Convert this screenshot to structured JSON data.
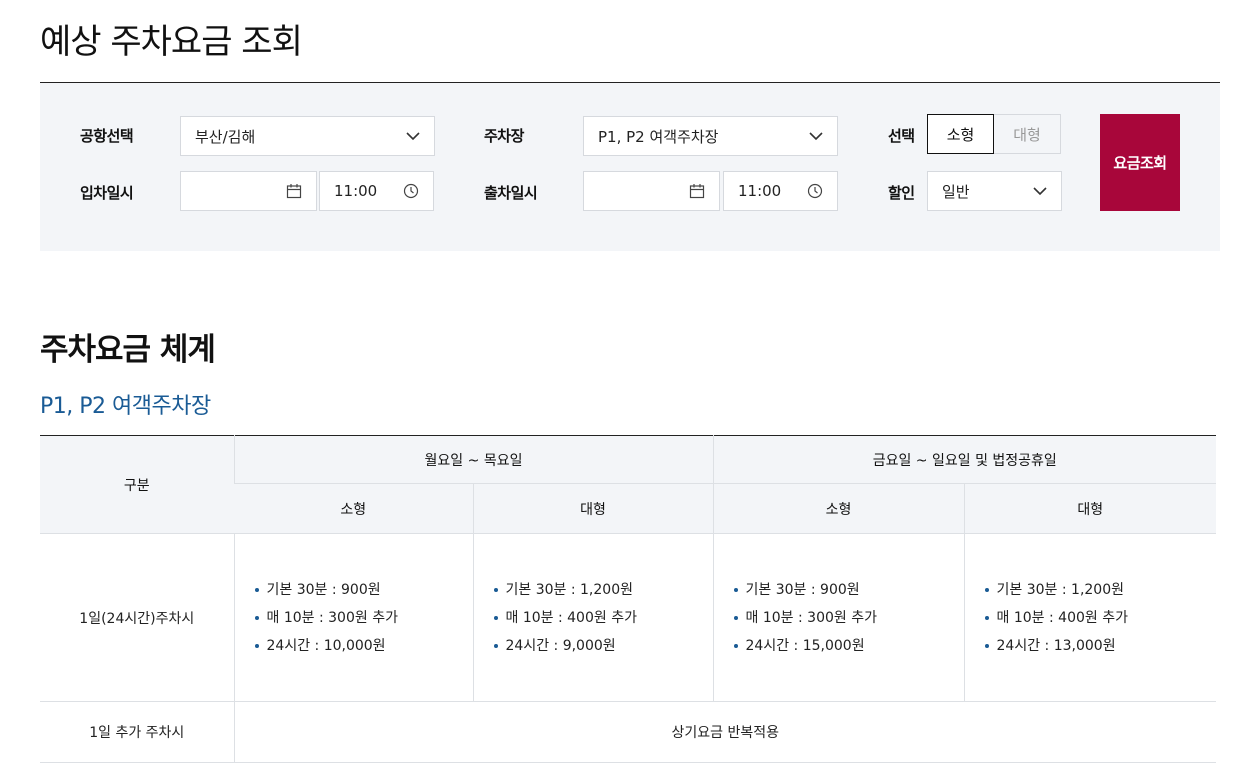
{
  "page": {
    "title": "예상 주차요금 조회"
  },
  "search": {
    "airport_label": "공항선택",
    "airport_value": "부산/김해",
    "lot_label": "주차장",
    "lot_value": "P1, P2 여객주차장",
    "size_label": "선택",
    "size_small": "소형",
    "size_large": "대형",
    "entry_label": "입차일시",
    "entry_date": "",
    "entry_time": "11:00",
    "exit_label": "출차일시",
    "exit_date": "",
    "exit_time": "11:00",
    "discount_label": "할인",
    "discount_value": "일반",
    "submit_label": "요금조회"
  },
  "fees": {
    "section_title": "주차요금 체계",
    "lot_title": "P1, P2 여객주차장",
    "col_category": "구분",
    "group_weekday": "월요일 ~ 목요일",
    "group_weekend": "금요일 ~ 일요일 및 법정공휴일",
    "col_small": "소형",
    "col_large": "대형",
    "row1_label": "1일(24시간)주차시",
    "row1": [
      [
        "기본 30분 : 900원",
        "매 10분 : 300원 추가",
        "24시간 : 10,000원"
      ],
      [
        "기본 30분 : 1,200원",
        "매 10분 : 400원 추가",
        "24시간 : 9,000원"
      ],
      [
        "기본 30분 : 900원",
        "매 10분 : 300원 추가",
        "24시간 : 15,000원"
      ],
      [
        "기본 30분 : 1,200원",
        "매 10분 : 400원 추가",
        "24시간 : 13,000원"
      ]
    ],
    "row2_label": "1일 추가 주차시",
    "row2_value": "상기요금 반복적용"
  },
  "colors": {
    "accent": "#a8063a",
    "link_blue": "#1a5b95",
    "panel_bg": "#f3f5f8"
  }
}
